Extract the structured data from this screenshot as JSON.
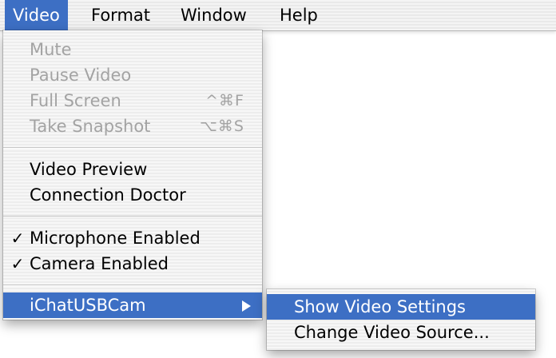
{
  "menubar": {
    "items": [
      {
        "label": "Video",
        "active": true
      },
      {
        "label": "Format",
        "active": false
      },
      {
        "label": "Window",
        "active": false
      },
      {
        "label": "Help",
        "active": false
      }
    ]
  },
  "video_menu": {
    "mute": {
      "label": "Mute",
      "enabled": false
    },
    "pause_video": {
      "label": "Pause Video",
      "enabled": false
    },
    "full_screen": {
      "label": "Full Screen",
      "shortcut": "^⌘F",
      "enabled": false
    },
    "take_snapshot": {
      "label": "Take Snapshot",
      "shortcut": "⌥⌘S",
      "enabled": false
    },
    "video_preview": {
      "label": "Video Preview",
      "enabled": true
    },
    "connection_doctor": {
      "label": "Connection Doctor",
      "enabled": true
    },
    "microphone_enabled": {
      "label": "Microphone Enabled",
      "checked": true,
      "check": "✓"
    },
    "camera_enabled": {
      "label": "Camera Enabled",
      "checked": true,
      "check": "✓"
    },
    "ichatusbcam": {
      "label": "iChatUSBCam",
      "highlighted": true,
      "has_submenu": true,
      "arrow_icon": "triangle-right-icon"
    }
  },
  "submenu": {
    "show_video_settings": {
      "label": "Show Video Settings",
      "highlighted": true
    },
    "change_video_source": {
      "label": "Change Video Source..."
    }
  },
  "colors": {
    "highlight": "#3d6fc4",
    "disabled_text": "#a3a3a3",
    "menu_text": "#000000",
    "highlight_text": "#ffffff"
  }
}
